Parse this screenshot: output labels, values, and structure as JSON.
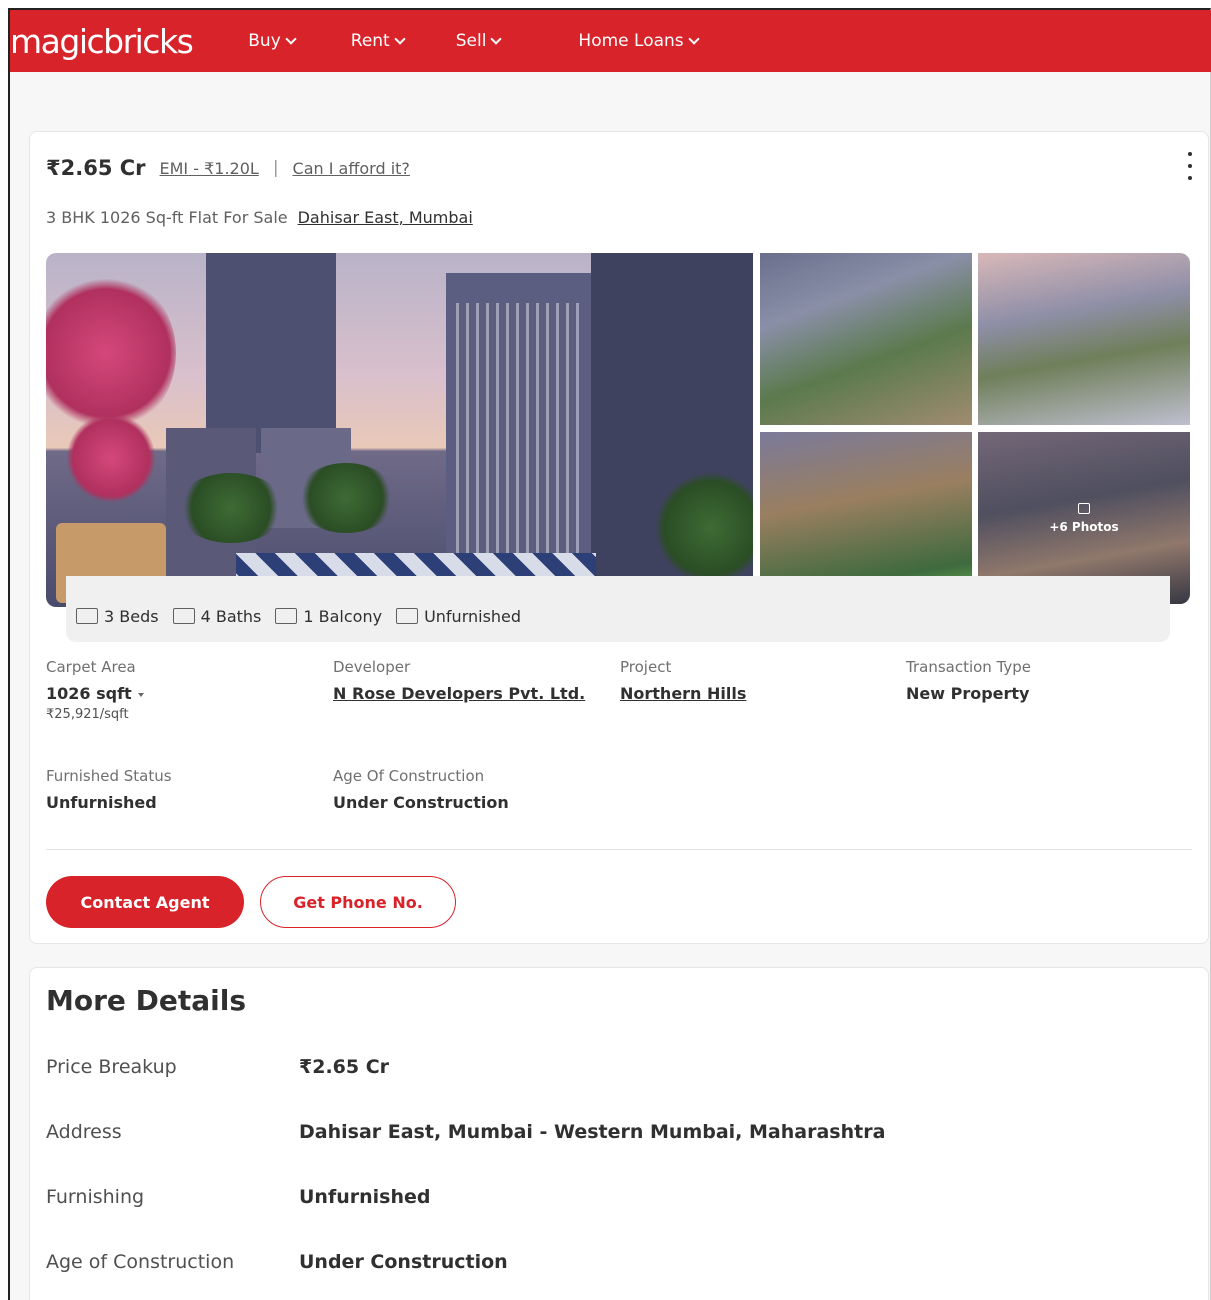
{
  "header": {
    "logo": "magicbricks",
    "nav": [
      {
        "label": "Buy"
      },
      {
        "label": "Rent"
      },
      {
        "label": "Sell"
      },
      {
        "label": "Home Loans"
      }
    ]
  },
  "listing": {
    "price": "₹2.65 Cr",
    "emi": "EMI - ₹1.20L",
    "separator": "|",
    "afford": "Can I afford it?",
    "title": "3 BHK 1026 Sq-ft Flat For Sale",
    "location": "Dahisar East, Mumbai",
    "photos_more": "+6 Photos",
    "amenities": [
      {
        "icon": "bed-icon",
        "label": "3 Beds"
      },
      {
        "icon": "bath-icon",
        "label": "4 Baths"
      },
      {
        "icon": "balcony-icon",
        "label": "1 Balcony"
      },
      {
        "icon": "furnishing-icon",
        "label": "Unfurnished"
      }
    ],
    "specs": {
      "carpet_area": {
        "label": "Carpet Area",
        "value": "1026 sqft",
        "sub": "₹25,921/sqft"
      },
      "developer": {
        "label": "Developer",
        "value": "N Rose Developers Pvt. Ltd."
      },
      "project": {
        "label": "Project",
        "value": "Northern Hills"
      },
      "transaction": {
        "label": "Transaction Type",
        "value": "New Property"
      },
      "furnished_status": {
        "label": "Furnished Status",
        "value": "Unfurnished"
      },
      "age": {
        "label": "Age Of Construction",
        "value": "Under Construction"
      }
    },
    "buttons": {
      "contact": "Contact Agent",
      "phone": "Get Phone No."
    }
  },
  "more_details": {
    "title": "More Details",
    "rows": [
      {
        "key": "Price Breakup",
        "value": "₹2.65 Cr"
      },
      {
        "key": "Address",
        "value": "Dahisar East, Mumbai - Western Mumbai, Maharashtra"
      },
      {
        "key": "Furnishing",
        "value": "Unfurnished"
      },
      {
        "key": "Age of Construction",
        "value": "Under Construction"
      }
    ]
  },
  "colors": {
    "brand": "#d8232a",
    "text": "#303030"
  }
}
